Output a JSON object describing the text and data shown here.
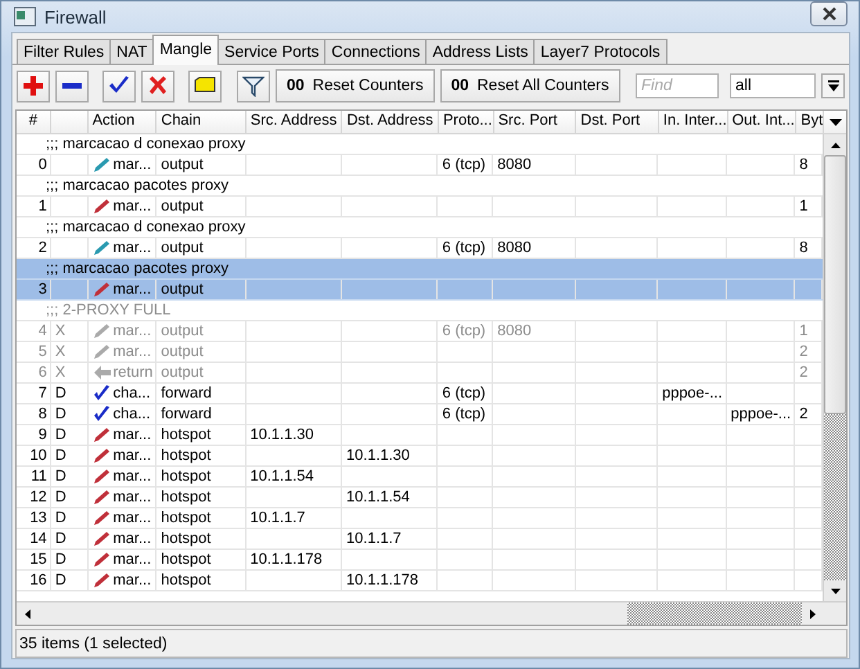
{
  "window": {
    "title": "Firewall"
  },
  "tabs": [
    {
      "label": "Filter Rules",
      "selected": false
    },
    {
      "label": "NAT",
      "selected": false
    },
    {
      "label": "Mangle",
      "selected": true
    },
    {
      "label": "Service Ports",
      "selected": false
    },
    {
      "label": "Connections",
      "selected": false
    },
    {
      "label": "Address Lists",
      "selected": false
    },
    {
      "label": "Layer7 Protocols",
      "selected": false
    }
  ],
  "toolbar": {
    "icon_buttons": [
      {
        "kind": "add"
      },
      {
        "kind": "remove"
      },
      {
        "kind": "enable"
      },
      {
        "kind": "disable"
      },
      {
        "kind": "comment"
      },
      {
        "kind": "filter"
      }
    ],
    "buttons": [
      {
        "prefix": "00",
        "label": "Reset Counters"
      },
      {
        "prefix": "00",
        "label": "Reset All Counters"
      }
    ],
    "find": {
      "placeholder": "Find"
    },
    "scope": {
      "value": "all"
    }
  },
  "table": {
    "columns": [
      "#",
      "",
      "Action",
      "Chain",
      "Src. Address",
      "Dst. Address",
      "Proto...",
      "Src. Port",
      "Dst. Port",
      "In. Inter...",
      "Out. Int...",
      "Byt"
    ],
    "rows": [
      {
        "kind": "comment",
        "text": ";;; marcacao d conexao proxy",
        "selected": false,
        "disabled": false
      },
      {
        "kind": "connmark",
        "cells": [
          "0",
          "",
          "mar...",
          "output",
          "",
          "",
          "6 (tcp)",
          "8080",
          "",
          "",
          "",
          "8"
        ],
        "selected": false,
        "disabled": false
      },
      {
        "kind": "comment",
        "text": ";;; marcacao pacotes proxy",
        "selected": false,
        "disabled": false
      },
      {
        "kind": "packetmark",
        "cells": [
          "1",
          "",
          "mar...",
          "output",
          "",
          "",
          "",
          "",
          "",
          "",
          "",
          "1"
        ],
        "selected": false,
        "disabled": false
      },
      {
        "kind": "comment",
        "text": ";;; marcacao d conexao proxy",
        "selected": false,
        "disabled": false
      },
      {
        "kind": "connmark",
        "cells": [
          "2",
          "",
          "mar...",
          "output",
          "",
          "",
          "6 (tcp)",
          "8080",
          "",
          "",
          "",
          "8"
        ],
        "selected": false,
        "disabled": false
      },
      {
        "kind": "comment",
        "text": ";;; marcacao pacotes proxy",
        "selected": true,
        "disabled": false
      },
      {
        "kind": "packetmark",
        "cells": [
          "3",
          "",
          "mar...",
          "output",
          "",
          "",
          "",
          "",
          "",
          "",
          "",
          ""
        ],
        "selected": true,
        "disabled": false
      },
      {
        "kind": "comment",
        "text": ";;; 2-PROXY FULL",
        "selected": false,
        "disabled": true
      },
      {
        "kind": "packetmark",
        "cells": [
          "4",
          "X",
          "mar...",
          "output",
          "",
          "",
          "6 (tcp)",
          "8080",
          "",
          "",
          "",
          "1"
        ],
        "selected": false,
        "disabled": true
      },
      {
        "kind": "packetmark",
        "cells": [
          "5",
          "X",
          "mar...",
          "output",
          "",
          "",
          "",
          "",
          "",
          "",
          "",
          "2"
        ],
        "selected": false,
        "disabled": true
      },
      {
        "kind": "return",
        "cells": [
          "6",
          "X",
          "return",
          "output",
          "",
          "",
          "",
          "",
          "",
          "",
          "",
          "2"
        ],
        "selected": false,
        "disabled": true
      },
      {
        "kind": "mss",
        "cells": [
          "7",
          "D",
          "cha...",
          "forward",
          "",
          "",
          "6 (tcp)",
          "",
          "",
          "pppoe-...",
          "",
          ""
        ],
        "selected": false,
        "disabled": false
      },
      {
        "kind": "mss",
        "cells": [
          "8",
          "D",
          "cha...",
          "forward",
          "",
          "",
          "6 (tcp)",
          "",
          "",
          "",
          "pppoe-...",
          "2"
        ],
        "selected": false,
        "disabled": false
      },
      {
        "kind": "packetmark",
        "cells": [
          "9",
          "D",
          "mar...",
          "hotspot",
          "10.1.1.30",
          "",
          "",
          "",
          "",
          "",
          "",
          ""
        ],
        "selected": false,
        "disabled": false
      },
      {
        "kind": "packetmark",
        "cells": [
          "10",
          "D",
          "mar...",
          "hotspot",
          "",
          "10.1.1.30",
          "",
          "",
          "",
          "",
          "",
          ""
        ],
        "selected": false,
        "disabled": false
      },
      {
        "kind": "packetmark",
        "cells": [
          "11",
          "D",
          "mar...",
          "hotspot",
          "10.1.1.54",
          "",
          "",
          "",
          "",
          "",
          "",
          ""
        ],
        "selected": false,
        "disabled": false
      },
      {
        "kind": "packetmark",
        "cells": [
          "12",
          "D",
          "mar...",
          "hotspot",
          "",
          "10.1.1.54",
          "",
          "",
          "",
          "",
          "",
          ""
        ],
        "selected": false,
        "disabled": false
      },
      {
        "kind": "packetmark",
        "cells": [
          "13",
          "D",
          "mar...",
          "hotspot",
          "10.1.1.7",
          "",
          "",
          "",
          "",
          "",
          "",
          ""
        ],
        "selected": false,
        "disabled": false
      },
      {
        "kind": "packetmark",
        "cells": [
          "14",
          "D",
          "mar...",
          "hotspot",
          "",
          "10.1.1.7",
          "",
          "",
          "",
          "",
          "",
          ""
        ],
        "selected": false,
        "disabled": false
      },
      {
        "kind": "packetmark",
        "cells": [
          "15",
          "D",
          "mar...",
          "hotspot",
          "10.1.1.178",
          "",
          "",
          "",
          "",
          "",
          "",
          ""
        ],
        "selected": false,
        "disabled": false
      },
      {
        "kind": "packetmark",
        "cells": [
          "16",
          "D",
          "mar...",
          "hotspot",
          "",
          "10.1.1.178",
          "",
          "",
          "",
          "",
          "",
          ""
        ],
        "selected": false,
        "disabled": false
      }
    ]
  },
  "status_bar": "35 items (1 selected)"
}
